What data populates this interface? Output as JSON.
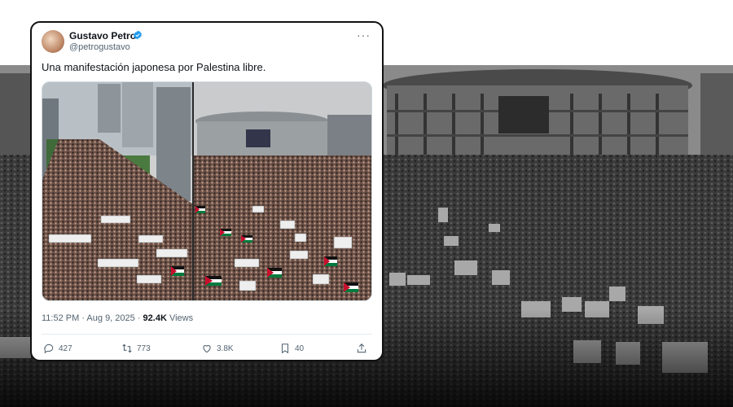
{
  "background": {
    "label": "protest-photo-background"
  },
  "tweet": {
    "author_name": "Gustavo Petro",
    "author_handle": "@petrogustavo",
    "more_icon": "more-dots-icon",
    "text": "Una manifestación japonesa por Palestina libre.",
    "time": "11:52 PM · Aug 9, 2025 · ",
    "views_count": "92.4K",
    "views_label": " Views",
    "actions": {
      "replies": "427",
      "reposts": "773",
      "likes": "3.8K",
      "bookmarks": "40"
    }
  },
  "colors": {
    "text_primary": "#0f1419",
    "text_secondary": "#536471",
    "verified": "#1d9bf0",
    "flag_red": "#c8102e",
    "flag_green": "#007a3d"
  }
}
